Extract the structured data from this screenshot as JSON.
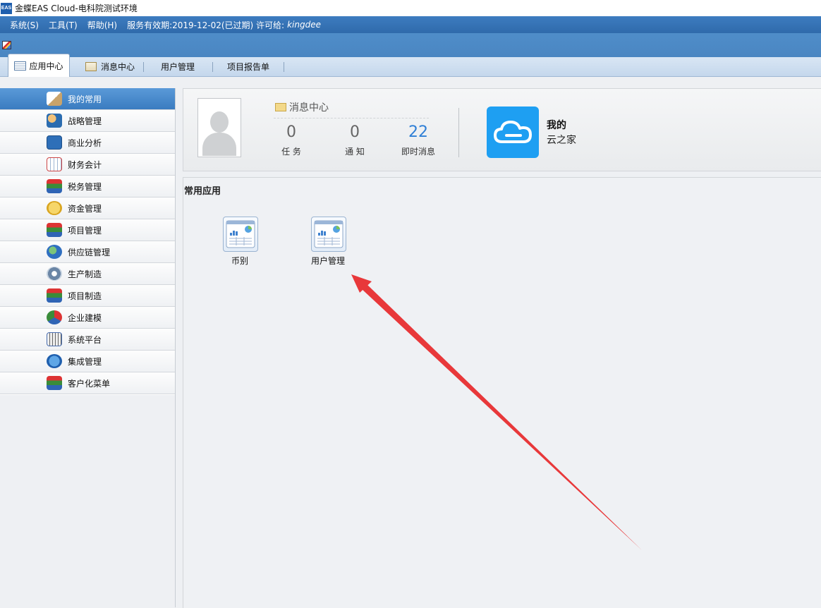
{
  "window": {
    "logo": "EAS",
    "title": "金蝶EAS Cloud-电科院测试环境"
  },
  "menu": {
    "items": [
      "系统(S)",
      "工具(T)",
      "帮助(H)"
    ],
    "license_info": "服务有效期:2019-12-02(已过期) 许可给:",
    "licensee": "kingdee"
  },
  "tabs": [
    {
      "label": "应用中心",
      "icon": "doc-icon",
      "active": true
    },
    {
      "label": "消息中心",
      "icon": "mail-icon",
      "active": false
    },
    {
      "label": "用户管理",
      "active": false
    },
    {
      "label": "项目报告单",
      "active": false
    }
  ],
  "sidebar": {
    "items": [
      {
        "label": "我的常用",
        "icon": "pen-icon",
        "active": true
      },
      {
        "label": "战略管理",
        "icon": "people-icon"
      },
      {
        "label": "商业分析",
        "icon": "dashboard-icon"
      },
      {
        "label": "财务会计",
        "icon": "calendar-icon"
      },
      {
        "label": "税务管理",
        "icon": "books-icon"
      },
      {
        "label": "资金管理",
        "icon": "money-icon"
      },
      {
        "label": "项目管理",
        "icon": "books-icon"
      },
      {
        "label": "供应链管理",
        "icon": "globe-icon"
      },
      {
        "label": "生产制造",
        "icon": "gears-icon"
      },
      {
        "label": "项目制造",
        "icon": "books-icon"
      },
      {
        "label": "企业建模",
        "icon": "blocks-icon"
      },
      {
        "label": "系统平台",
        "icon": "keyboard-icon"
      },
      {
        "label": "集成管理",
        "icon": "eas-icon"
      },
      {
        "label": "客户化菜单",
        "icon": "books-icon"
      }
    ]
  },
  "profile": {
    "message_center": "消息中心",
    "stats": [
      {
        "value": "0",
        "label": "任 务"
      },
      {
        "value": "0",
        "label": "通 知"
      },
      {
        "value": "22",
        "label": "即时消息"
      }
    ],
    "cloud_title": "我的",
    "cloud_subtitle": "云之家"
  },
  "common_apps": {
    "title": "常用应用",
    "items": [
      {
        "label": "币别",
        "icon": "report-icon"
      },
      {
        "label": "用户管理",
        "icon": "report-icon"
      }
    ]
  },
  "colors": {
    "menubar": "#3473b5",
    "sidebar_active": "#4a8bcd",
    "cloud_tile": "#1e9ff2",
    "annotation_arrow": "#e8383a"
  }
}
